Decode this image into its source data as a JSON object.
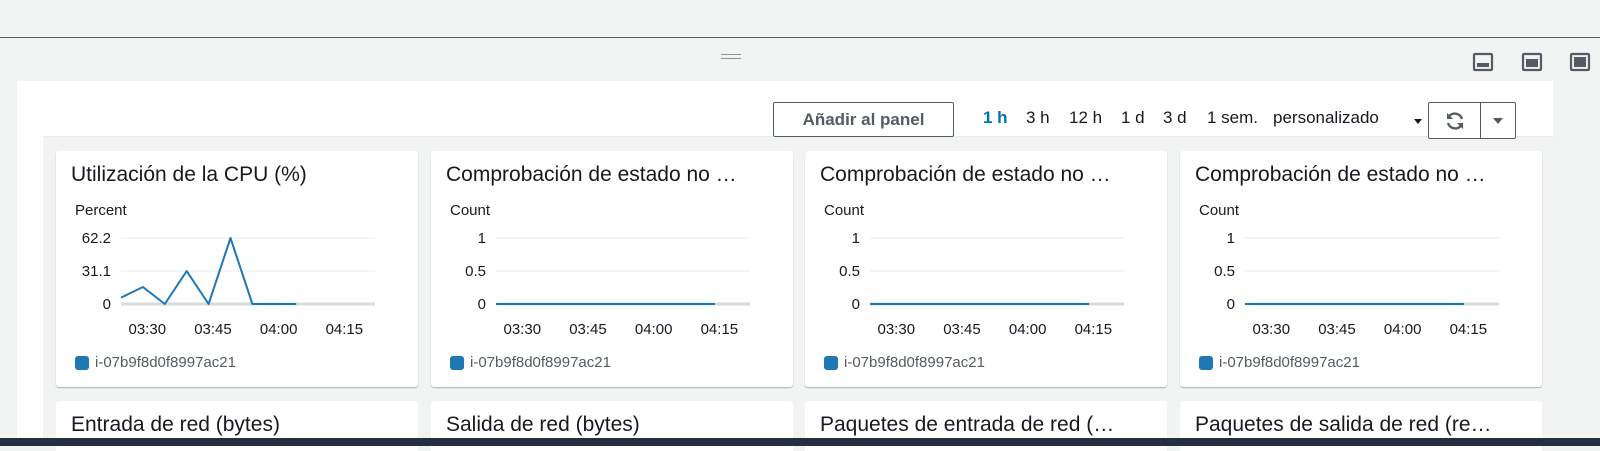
{
  "toolbar": {
    "add_to_panel": "Añadir al panel",
    "ranges": [
      "1 h",
      "3 h",
      "12 h",
      "1 d",
      "3 d",
      "1 sem."
    ],
    "active_range": "1 h",
    "custom": "personalizado"
  },
  "colors": {
    "series": "#1f78b4",
    "accent": "#0073bb"
  },
  "legend_label": "i-07b9f8d0f8997ac21",
  "charts": [
    {
      "title": "Utilización de la CPU (%)",
      "unit": "Percent"
    },
    {
      "title": "Comprobación de estado no …",
      "unit": "Count"
    },
    {
      "title": "Comprobación de estado no …",
      "unit": "Count"
    },
    {
      "title": "Comprobación de estado no …",
      "unit": "Count"
    }
  ],
  "row2_titles": [
    "Entrada de red (bytes)",
    "Salida de red (bytes)",
    "Paquetes de entrada de red (…",
    "Paquetes de salida de red (re…"
  ],
  "chart_data": [
    {
      "type": "line",
      "title": "Utilización de la CPU (%)",
      "ylabel": "Percent",
      "ylim": [
        0,
        62.2
      ],
      "yticks": [
        "0",
        "31.1",
        "62.2"
      ],
      "xticks": [
        "03:30",
        "03:45",
        "04:00",
        "04:15"
      ],
      "x": [
        "03:24",
        "03:29",
        "03:34",
        "03:39",
        "03:44",
        "03:49",
        "03:54",
        "03:59",
        "04:04"
      ],
      "series": [
        {
          "name": "i-07b9f8d0f8997ac21",
          "values": [
            6,
            16,
            0,
            31,
            0,
            62.2,
            0,
            0,
            0
          ]
        }
      ],
      "grid": true
    },
    {
      "type": "line",
      "title": "Comprobación de estado no …",
      "ylabel": "Count",
      "ylim": [
        0,
        1
      ],
      "yticks": [
        "0",
        "0.5",
        "1"
      ],
      "xticks": [
        "03:30",
        "03:45",
        "04:00",
        "04:15"
      ],
      "x": [
        "03:24",
        "03:29",
        "03:34",
        "03:39",
        "03:44",
        "03:49",
        "03:54",
        "03:59",
        "04:04",
        "04:09",
        "04:14"
      ],
      "series": [
        {
          "name": "i-07b9f8d0f8997ac21",
          "values": [
            0,
            0,
            0,
            0,
            0,
            0,
            0,
            0,
            0,
            0,
            0
          ]
        }
      ],
      "grid": true
    },
    {
      "type": "line",
      "title": "Comprobación de estado no …",
      "ylabel": "Count",
      "ylim": [
        0,
        1
      ],
      "yticks": [
        "0",
        "0.5",
        "1"
      ],
      "xticks": [
        "03:30",
        "03:45",
        "04:00",
        "04:15"
      ],
      "x": [
        "03:24",
        "03:29",
        "03:34",
        "03:39",
        "03:44",
        "03:49",
        "03:54",
        "03:59",
        "04:04",
        "04:09",
        "04:14"
      ],
      "series": [
        {
          "name": "i-07b9f8d0f8997ac21",
          "values": [
            0,
            0,
            0,
            0,
            0,
            0,
            0,
            0,
            0,
            0,
            0
          ]
        }
      ],
      "grid": true
    },
    {
      "type": "line",
      "title": "Comprobación de estado no …",
      "ylabel": "Count",
      "ylim": [
        0,
        1
      ],
      "yticks": [
        "0",
        "0.5",
        "1"
      ],
      "xticks": [
        "03:30",
        "03:45",
        "04:00",
        "04:15"
      ],
      "x": [
        "03:24",
        "03:29",
        "03:34",
        "03:39",
        "03:44",
        "03:49",
        "03:54",
        "03:59",
        "04:04",
        "04:09",
        "04:14"
      ],
      "series": [
        {
          "name": "i-07b9f8d0f8997ac21",
          "values": [
            0,
            0,
            0,
            0,
            0,
            0,
            0,
            0,
            0,
            0,
            0
          ]
        }
      ],
      "grid": true
    }
  ]
}
